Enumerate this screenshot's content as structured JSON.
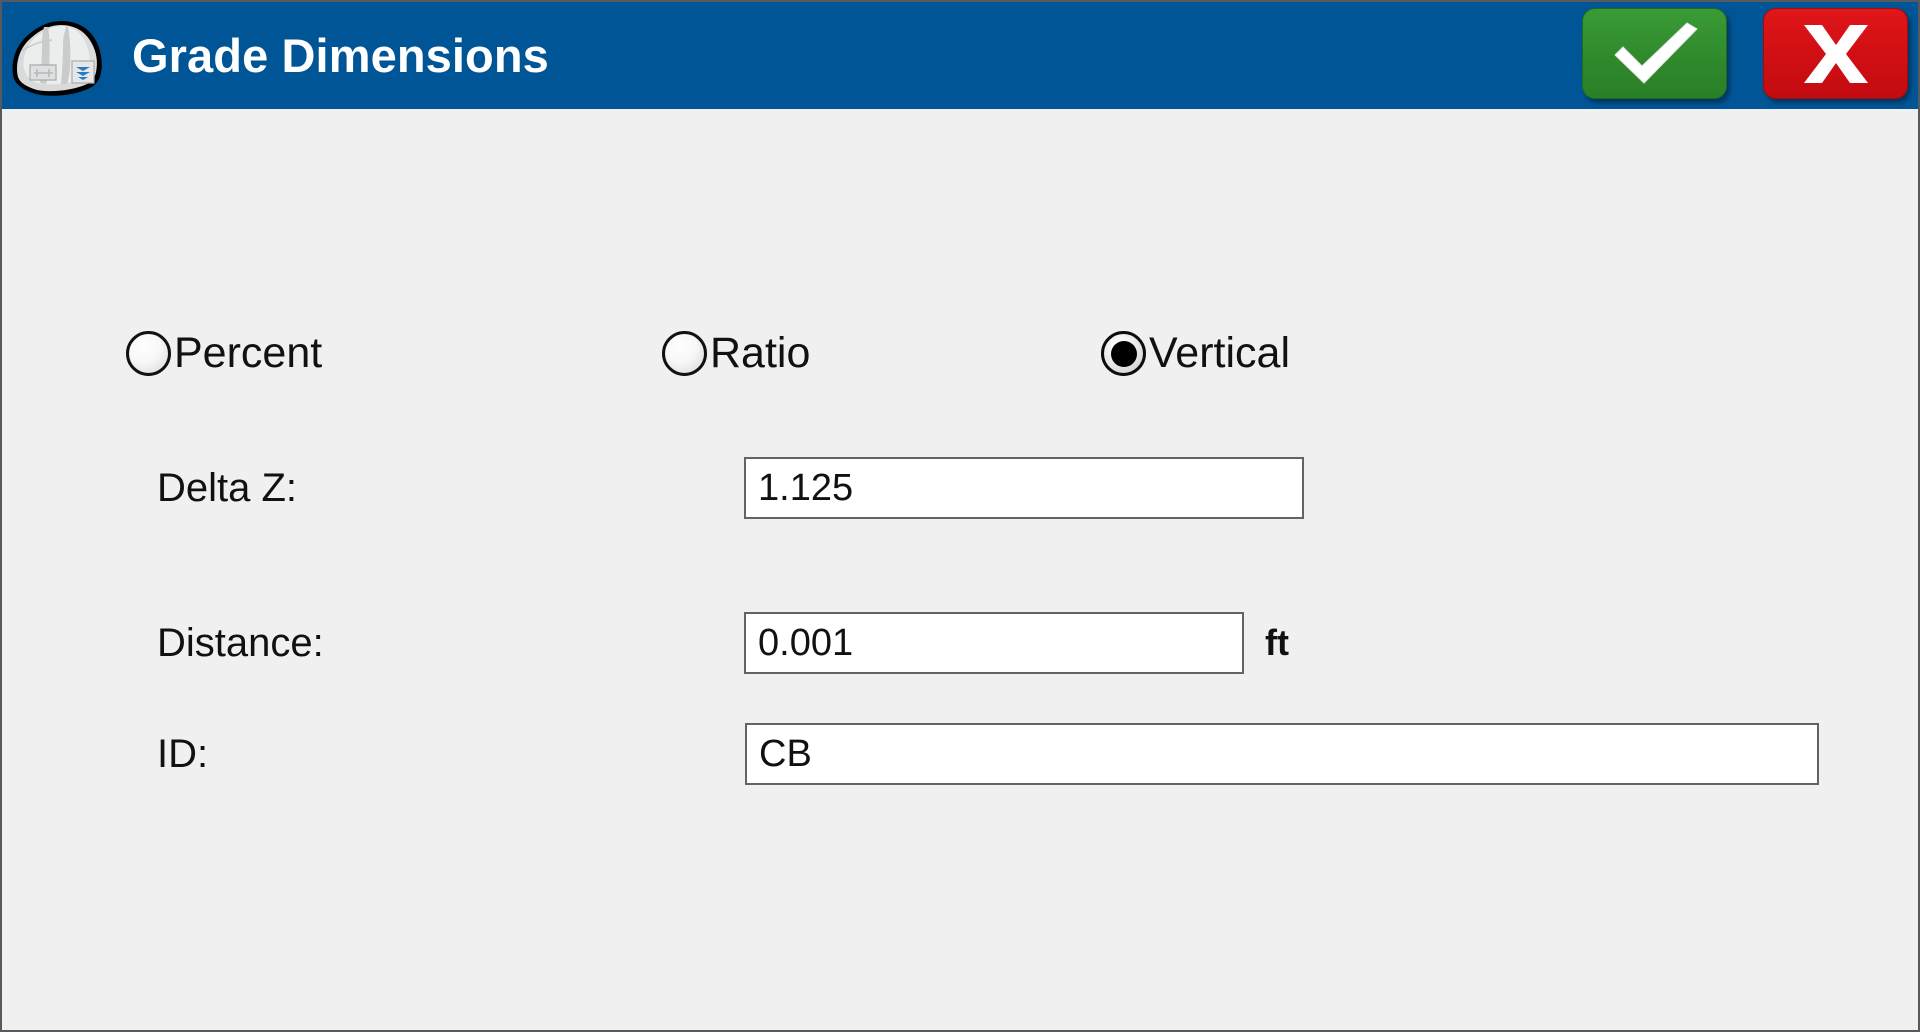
{
  "window": {
    "background_color": "#f0f0f0",
    "border_color": "#555a5e"
  },
  "titlebar": {
    "title": "Grade Dimensions",
    "background_color": "#005596",
    "title_color": "#ffffff",
    "app_icon_name": "hard-hat-icon",
    "actions": [
      {
        "name": "accept-button",
        "icon": "checkmark-icon",
        "label": "",
        "color": "#2f8a2c"
      },
      {
        "name": "cancel-button",
        "icon": "x-icon",
        "label": "X",
        "color": "#cf0f13"
      }
    ]
  },
  "form": {
    "grade_mode": {
      "group_name": "grade-mode",
      "selected": "Vertical",
      "options": [
        {
          "label": "Percent",
          "selected": false
        },
        {
          "label": "Ratio",
          "selected": false
        },
        {
          "label": "Vertical",
          "selected": true
        }
      ]
    },
    "fields": [
      {
        "name": "delta-z",
        "label": "Delta Z:",
        "value": "1.125",
        "placeholder": "",
        "unit": ""
      },
      {
        "name": "distance",
        "label": "Distance:",
        "value": "0.001",
        "placeholder": "",
        "unit": "ft"
      },
      {
        "name": "id",
        "label": "ID:",
        "value": "CB",
        "placeholder": "",
        "unit": ""
      }
    ]
  }
}
